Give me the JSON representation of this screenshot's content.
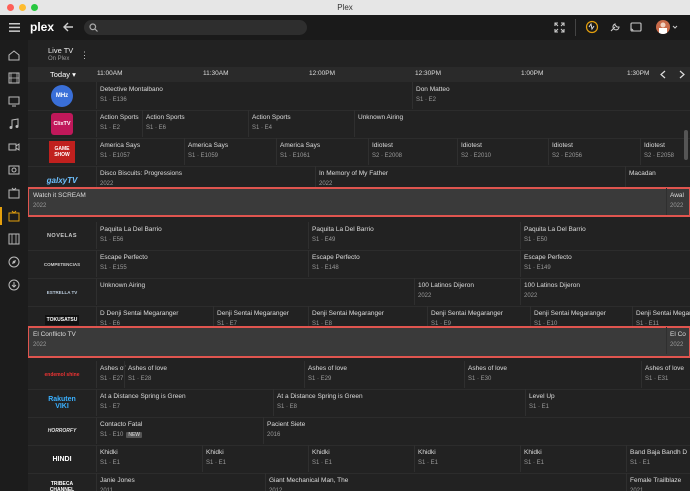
{
  "window": {
    "title": "Plex"
  },
  "topbar": {
    "logo": "plex",
    "search_placeholder": ""
  },
  "header": {
    "title": "Live TV",
    "subtitle": "On Plex",
    "menu": "⋮"
  },
  "timebar": {
    "today": "Today ▾",
    "times": [
      "11:00AM",
      "11:30AM",
      "12:00PM",
      "12:30PM",
      "1:00PM",
      "1:30PM"
    ]
  },
  "logos": {
    "mhz": "MHz",
    "clixtv": "ClixTV",
    "gameshow": "GAME SHOW",
    "galxy": "galxyTV",
    "novelas": "NOVELAS",
    "competencias": "COMPETENCIAS",
    "estrella": "ESTRELLA TV",
    "tokusatsu": "TOKUSATSU",
    "endemol": "endemol shine",
    "rakuten": "Rakuten VIKI",
    "horrorfy": "HORRORFY",
    "hindi": "HINDI",
    "tribeca": "TRIBECA CHANNEL"
  },
  "rows": {
    "r1": {
      "p1t": "Detective Montalbano",
      "p1s": "S1 · E136",
      "p2t": "Don Matteo",
      "p2s": "S1 · E2"
    },
    "r2": {
      "p1t": "Action Sports",
      "p1s": "S1 · E2",
      "p2t": "Action Sports",
      "p2s": "S1 · E6",
      "p3t": "Action Sports",
      "p3s": "S1 · E4",
      "p4t": "Unknown Airing"
    },
    "r3": {
      "p1t": "America Says",
      "p1s": "S1 · E1057",
      "p2t": "America Says",
      "p2s": "S1 · E1059",
      "p3t": "America Says",
      "p3s": "S1 · E1061",
      "p4t": "Idiotest",
      "p4s": "S2 · E2008",
      "p5t": "Idiotest",
      "p5s": "S2 · E2010",
      "p6t": "Idiotest",
      "p6s": "S2 · E2056",
      "p7t": "Idiotest",
      "p7s": "S2 · E2058"
    },
    "r4": {
      "p1t": "Disco Biscuits: Progressions",
      "p1s": "2022",
      "p2t": "In Memory of My Father",
      "p2s": "2022",
      "p3t": "Macadan"
    },
    "r5": {
      "p1t": "Watch it SCREAM",
      "p1s": "2022",
      "p2t": "Awal",
      "p2s": "2022"
    },
    "r6": {
      "p1t": "Paquita La Del Barrio",
      "p1s": "S1 · E56",
      "p2t": "Paquita La Del Barrio",
      "p2s": "S1 · E49",
      "p3t": "Paquita La Del Barrio",
      "p3s": "S1 · E50"
    },
    "r7": {
      "p1t": "Escape Perfecto",
      "p1s": "S1 · E155",
      "p2t": "Escape Perfecto",
      "p2s": "S1 · E148",
      "p3t": "Escape Perfecto",
      "p3s": "S1 · E149"
    },
    "r8": {
      "p1t": "Unknown Airing",
      "p2t": "100 Latinos Dijeron",
      "p2s": "2022",
      "p3t": "100 Latinos Dijeron",
      "p3s": "2022"
    },
    "r9": {
      "p1t": "D",
      "p1s": "S1 · E6",
      "p2t": "Denji Sentai Megaranger",
      "p2s": "S1 · E7",
      "p3t": "Denji Sentai Megaranger",
      "p3s": "S1 · E8",
      "p4t": "Denji Sentai Megaranger",
      "p4s": "S1 · E9",
      "p5t": "Denji Sentai Megaranger",
      "p5s": "S1 · E10",
      "p6t": "Denji Sentai Megaranger",
      "p6s": "S1 · E11",
      "p0t": "Denji Sentai Megaranger"
    },
    "r10": {
      "p1t": "El Conflicto TV",
      "p1s": "2022",
      "p2t": "El Co",
      "p2s": "2022"
    },
    "r11": {
      "p1t": "Ashes of",
      "p1s": "S1 · E27",
      "p2t": "Ashes of love",
      "p2s": "S1 · E28",
      "p3t": "Ashes of love",
      "p3s": "S1 · E29",
      "p4t": "Ashes of love",
      "p4s": "S1 · E30",
      "p5t": "Ashes of love",
      "p5s": "S1 · E31"
    },
    "r12": {
      "p1t": "At a Distance Spring is Green",
      "p1s": "S1 · E7",
      "p2t": "At a Distance Spring is Green",
      "p2s": "S1 · E8",
      "p3t": "Level Up",
      "p3s": "S1 · E1"
    },
    "r13": {
      "p1t": "Contacto Fatal",
      "p1s": "S1 · E10",
      "p1new": "NEW",
      "p2t": "Pacient Siete",
      "p2s": "2016"
    },
    "r14": {
      "p1t": "Khidki",
      "p1s": "S1 · E1",
      "p2t": "Khidki",
      "p2s": "S1 · E1",
      "p3t": "Khidki",
      "p3s": "S1 · E1",
      "p4t": "Khidki",
      "p4s": "S1 · E1",
      "p5t": "Khidki",
      "p5s": "S1 · E1",
      "p6t": "Band Baja Bandh D",
      "p6s": "S1 · E1"
    },
    "r15": {
      "p1t": "Janie Jones",
      "p1s": "2011",
      "p2t": "Giant Mechanical Man, The",
      "p2s": "2012",
      "p3t": "Female Trailblaze",
      "p3s": "2021"
    }
  }
}
